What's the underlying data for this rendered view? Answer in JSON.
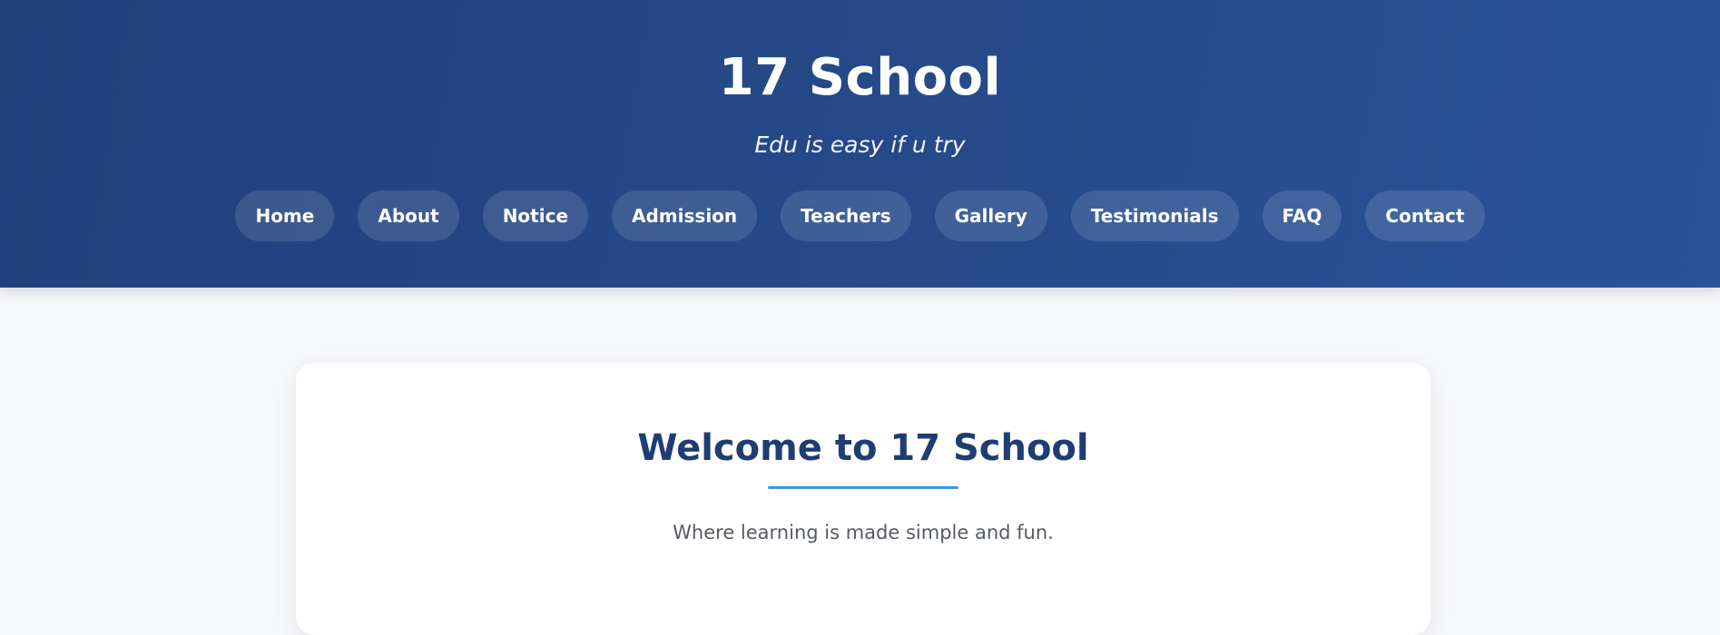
{
  "header": {
    "title": "17 School",
    "tagline": "Edu is easy if u try"
  },
  "nav": {
    "items": [
      {
        "label": "Home"
      },
      {
        "label": "About"
      },
      {
        "label": "Notice"
      },
      {
        "label": "Admission"
      },
      {
        "label": "Teachers"
      },
      {
        "label": "Gallery"
      },
      {
        "label": "Testimonials"
      },
      {
        "label": "FAQ"
      },
      {
        "label": "Contact"
      }
    ]
  },
  "main": {
    "welcome_title": "Welcome to 17 School",
    "welcome_text": "Where learning is made simple and fun."
  },
  "colors": {
    "header_gradient_start": "#21407a",
    "header_gradient_end": "#2a5399",
    "page_background": "#f7f8fa",
    "heading": "#1e3d72",
    "accent_underline": "#3a98dc",
    "body_text": "#555a63"
  }
}
